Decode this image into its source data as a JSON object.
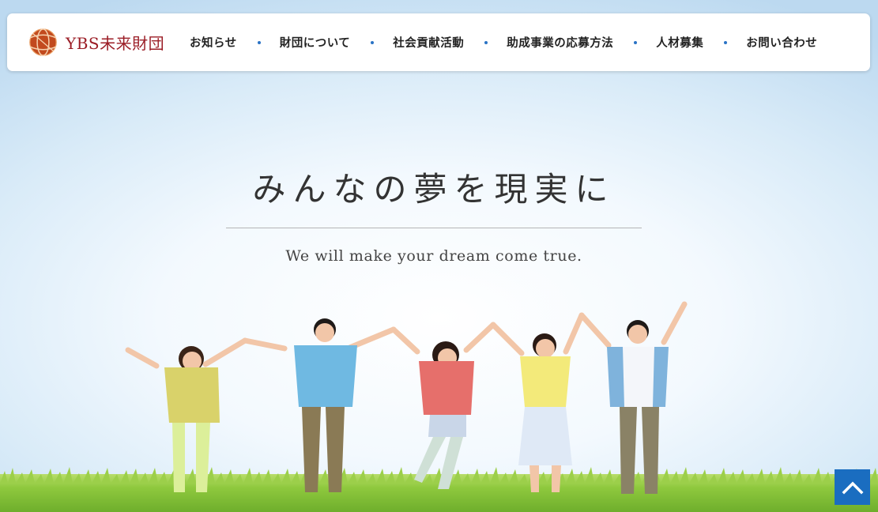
{
  "header": {
    "logo_text": "YBS未来財団",
    "logo_icon": "globe-icon",
    "nav": [
      {
        "label": "お知らせ"
      },
      {
        "label": "財団について"
      },
      {
        "label": "社会貢献活動"
      },
      {
        "label": "助成事業の応募方法"
      },
      {
        "label": "人材募集"
      },
      {
        "label": "お問い合わせ"
      }
    ],
    "accent_color": "#2a73c5",
    "brand_color": "#9b1d26"
  },
  "hero": {
    "title": "みんなの夢を現実に",
    "subtitle": "We will make your dream come true."
  },
  "back_to_top": {
    "icon": "chevron-up-icon",
    "color": "#1a6dc0"
  }
}
